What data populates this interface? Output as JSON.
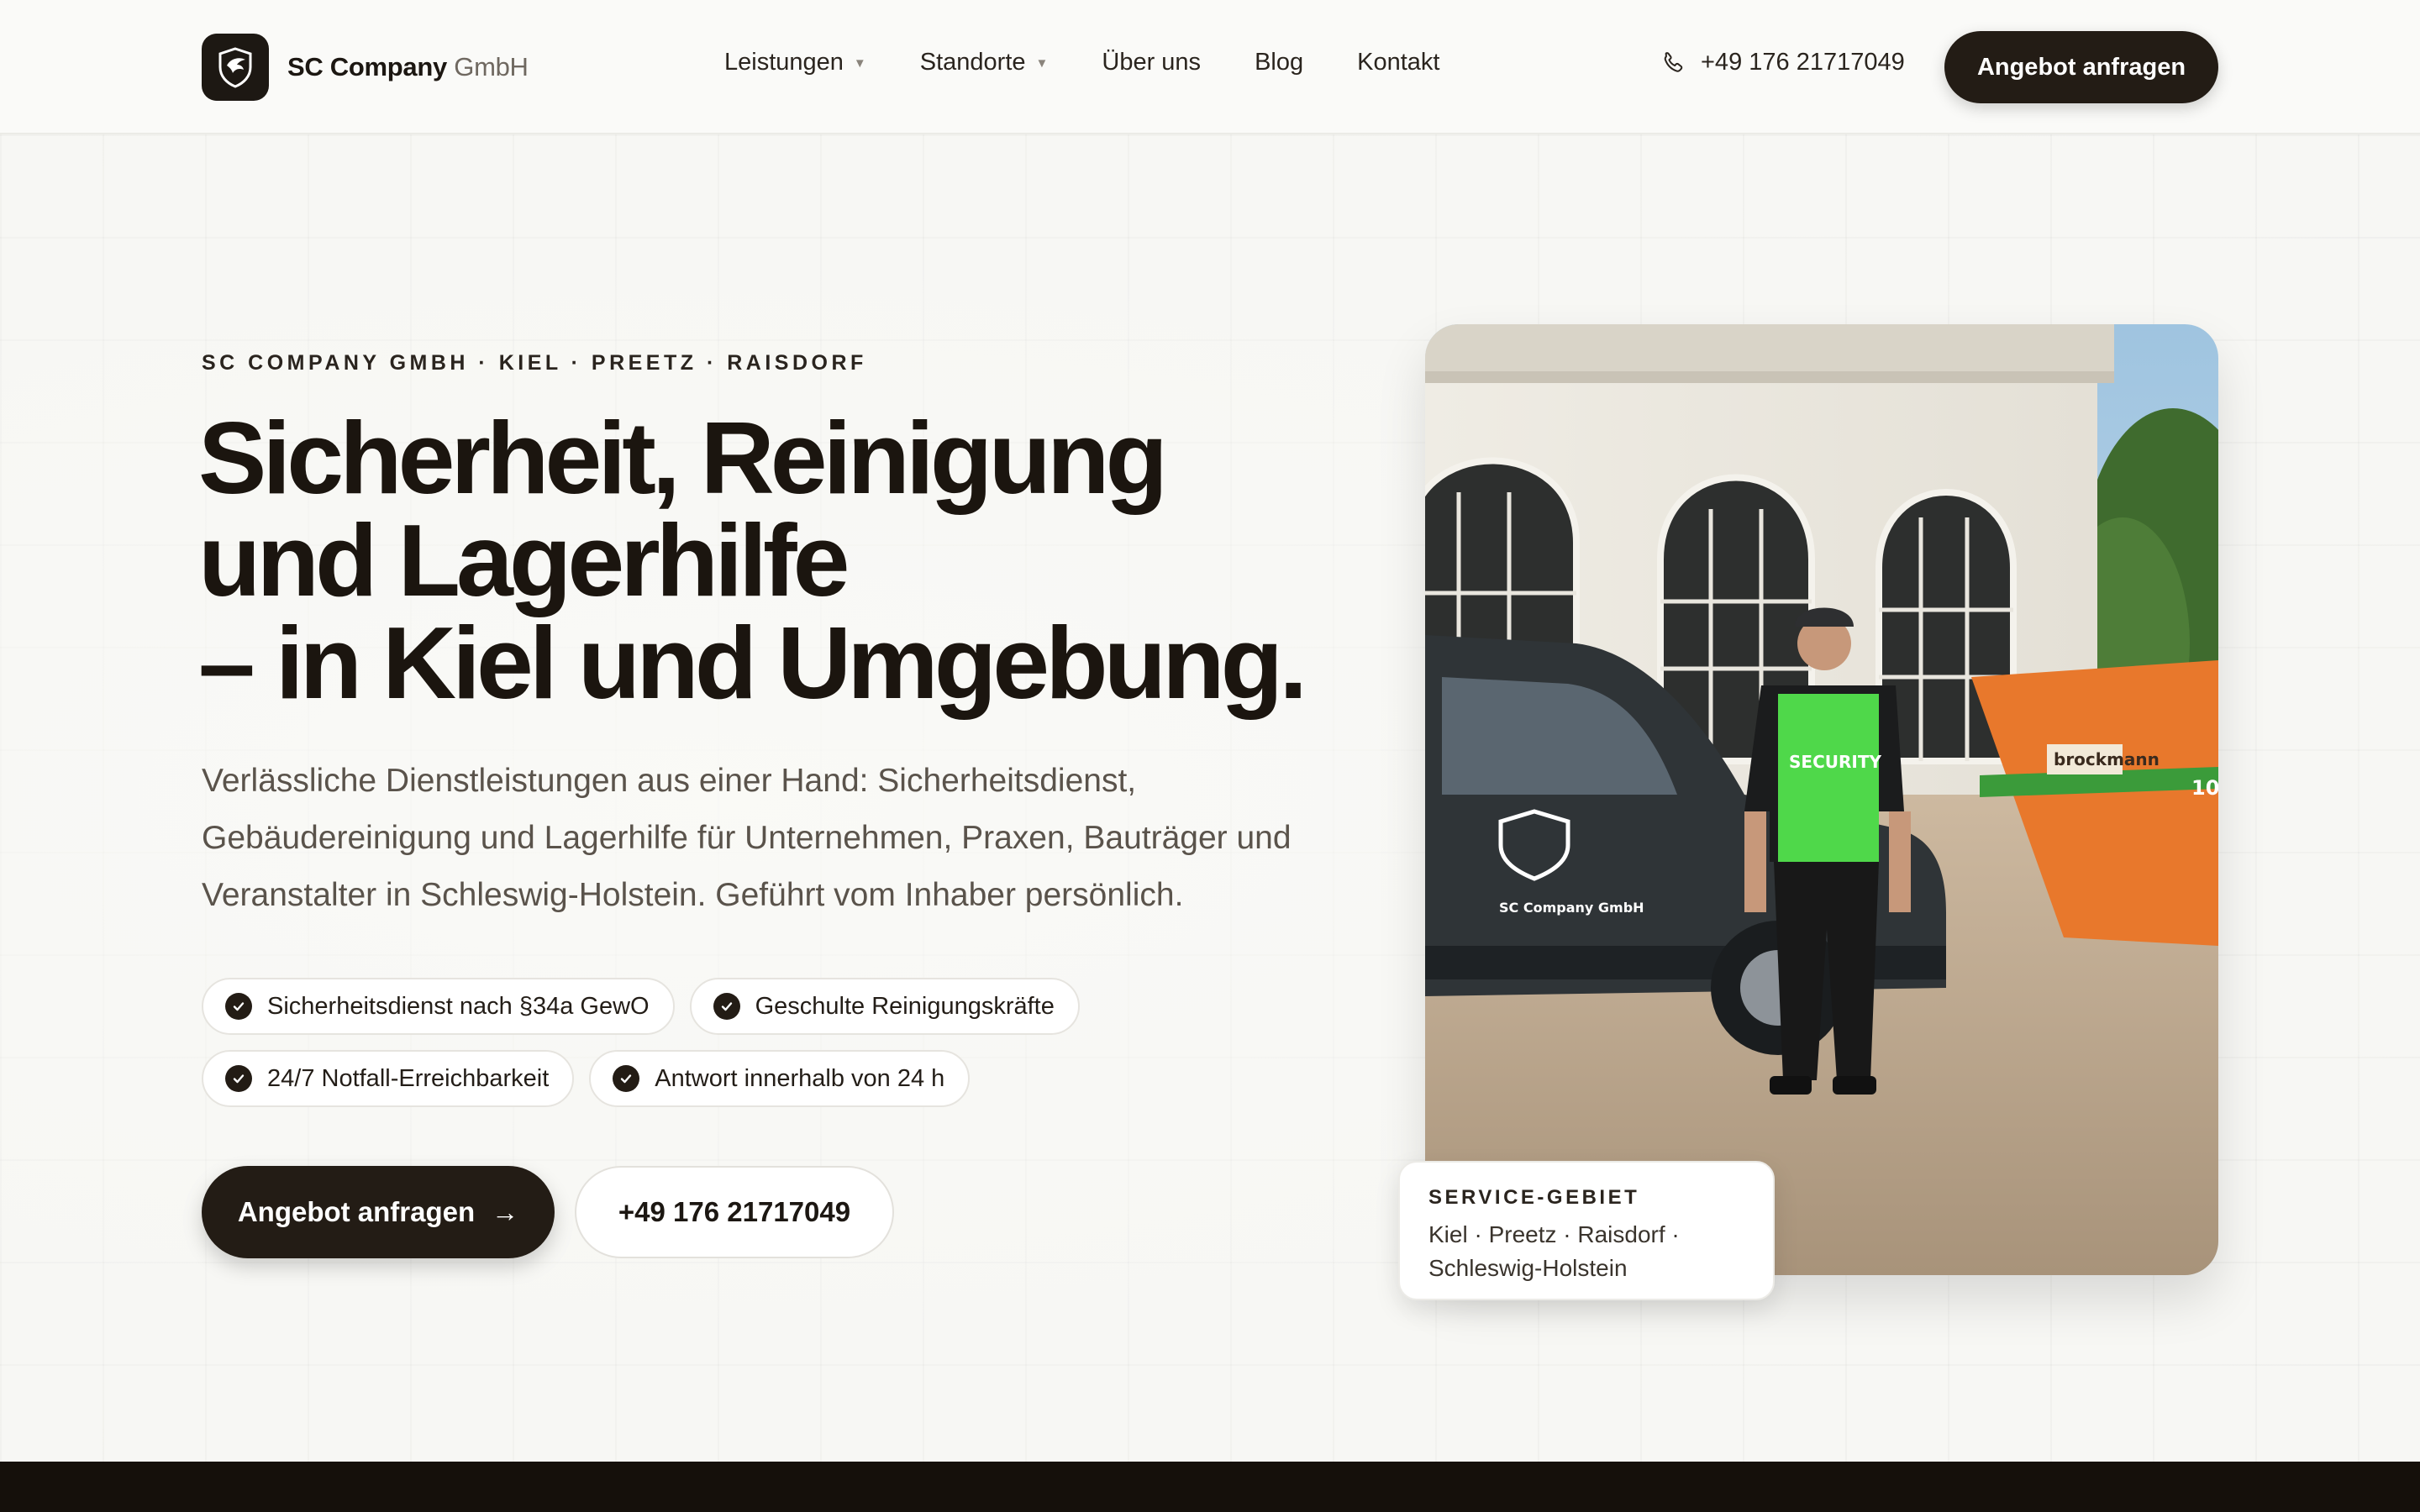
{
  "header": {
    "brand_name": "SC Company",
    "brand_suffix": "GmbH",
    "nav": [
      {
        "label": "Leistungen",
        "has_dropdown": true
      },
      {
        "label": "Standorte",
        "has_dropdown": true
      },
      {
        "label": "Über uns",
        "has_dropdown": false
      },
      {
        "label": "Blog",
        "has_dropdown": false
      },
      {
        "label": "Kontakt",
        "has_dropdown": false
      }
    ],
    "phone": "+49 176 21717049",
    "cta_label": "Angebot anfragen"
  },
  "hero": {
    "eyebrow": "SC COMPANY GMBH · KIEL · PREETZ · RAISDORF",
    "headline": [
      "Sicherheit, Reinigung",
      "und Lagerhilfe",
      "– in Kiel und Umgebung."
    ],
    "lede": "Verlässliche Dienstleistungen aus einer Hand: Sicherheitsdienst, Gebäudereinigung und Lagerhilfe für Unternehmen, Praxen, Bauträger und Veranstalter in Schleswig-Holstein. Geführt vom Inhaber persönlich.",
    "chips": [
      "Sicherheitsdienst nach §34a GewO",
      "Geschulte Reinigungskräfte",
      "24/7 Notfall-Erreichbarkeit",
      "Antwort innerhalb von 24 h"
    ],
    "primary_cta": "Angebot anfragen",
    "primary_cta_icon": "arrow-right-icon",
    "secondary_cta": "+49 176 21717049"
  },
  "photo": {
    "van_logo_text": "SC Company GmbH",
    "vest_text": "SECURITY",
    "container_text": "brockmann",
    "container_number": "10"
  },
  "service_card": {
    "label": "SERVICE-GEBIET",
    "text": "Kiel · Preetz · Raisdorf · Schleswig-Holstein"
  },
  "colors": {
    "accent_dark": "#231c15",
    "background": "#f7f7f4",
    "vest_green": "#4fd84a",
    "container_orange": "#e8782c"
  }
}
